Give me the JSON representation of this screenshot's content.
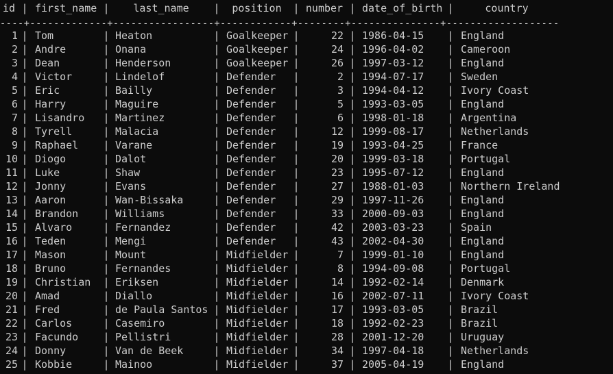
{
  "query_result": {
    "columns": [
      {
        "key": "id",
        "label": "id"
      },
      {
        "key": "first_name",
        "label": "first_name"
      },
      {
        "key": "last_name",
        "label": "last_name"
      },
      {
        "key": "position",
        "label": "position"
      },
      {
        "key": "number",
        "label": "number"
      },
      {
        "key": "date_of_birth",
        "label": "date_of_birth"
      },
      {
        "key": "country",
        "label": "country"
      }
    ],
    "divider": "----+-------------+-----------------+------------+--------+---------------+-------------------",
    "rows": [
      {
        "id": "1",
        "first_name": "Tom",
        "last_name": "Heaton",
        "position": "Goalkeeper",
        "number": "22",
        "date_of_birth": "1986-04-15",
        "country": "England"
      },
      {
        "id": "2",
        "first_name": "Andre",
        "last_name": "Onana",
        "position": "Goalkeeper",
        "number": "24",
        "date_of_birth": "1996-04-02",
        "country": "Cameroon"
      },
      {
        "id": "3",
        "first_name": "Dean",
        "last_name": "Henderson",
        "position": "Goalkeeper",
        "number": "26",
        "date_of_birth": "1997-03-12",
        "country": "England"
      },
      {
        "id": "4",
        "first_name": "Victor",
        "last_name": "Lindelof",
        "position": "Defender",
        "number": "2",
        "date_of_birth": "1994-07-17",
        "country": "Sweden"
      },
      {
        "id": "5",
        "first_name": "Eric",
        "last_name": "Bailly",
        "position": "Defender",
        "number": "3",
        "date_of_birth": "1994-04-12",
        "country": "Ivory Coast"
      },
      {
        "id": "6",
        "first_name": "Harry",
        "last_name": "Maguire",
        "position": "Defender",
        "number": "5",
        "date_of_birth": "1993-03-05",
        "country": "England"
      },
      {
        "id": "7",
        "first_name": "Lisandro",
        "last_name": "Martinez",
        "position": "Defender",
        "number": "6",
        "date_of_birth": "1998-01-18",
        "country": "Argentina"
      },
      {
        "id": "8",
        "first_name": "Tyrell",
        "last_name": "Malacia",
        "position": "Defender",
        "number": "12",
        "date_of_birth": "1999-08-17",
        "country": "Netherlands"
      },
      {
        "id": "9",
        "first_name": "Raphael",
        "last_name": "Varane",
        "position": "Defender",
        "number": "19",
        "date_of_birth": "1993-04-25",
        "country": "France"
      },
      {
        "id": "10",
        "first_name": "Diogo",
        "last_name": "Dalot",
        "position": "Defender",
        "number": "20",
        "date_of_birth": "1999-03-18",
        "country": "Portugal"
      },
      {
        "id": "11",
        "first_name": "Luke",
        "last_name": "Shaw",
        "position": "Defender",
        "number": "23",
        "date_of_birth": "1995-07-12",
        "country": "England"
      },
      {
        "id": "12",
        "first_name": "Jonny",
        "last_name": "Evans",
        "position": "Defender",
        "number": "27",
        "date_of_birth": "1988-01-03",
        "country": "Northern Ireland"
      },
      {
        "id": "13",
        "first_name": "Aaron",
        "last_name": "Wan-Bissaka",
        "position": "Defender",
        "number": "29",
        "date_of_birth": "1997-11-26",
        "country": "England"
      },
      {
        "id": "14",
        "first_name": "Brandon",
        "last_name": "Williams",
        "position": "Defender",
        "number": "33",
        "date_of_birth": "2000-09-03",
        "country": "England"
      },
      {
        "id": "15",
        "first_name": "Alvaro",
        "last_name": "Fernandez",
        "position": "Defender",
        "number": "42",
        "date_of_birth": "2003-03-23",
        "country": "Spain"
      },
      {
        "id": "16",
        "first_name": "Teden",
        "last_name": "Mengi",
        "position": "Defender",
        "number": "43",
        "date_of_birth": "2002-04-30",
        "country": "England"
      },
      {
        "id": "17",
        "first_name": "Mason",
        "last_name": "Mount",
        "position": "Midfielder",
        "number": "7",
        "date_of_birth": "1999-01-10",
        "country": "England"
      },
      {
        "id": "18",
        "first_name": "Bruno",
        "last_name": "Fernandes",
        "position": "Midfielder",
        "number": "8",
        "date_of_birth": "1994-09-08",
        "country": "Portugal"
      },
      {
        "id": "19",
        "first_name": "Christian",
        "last_name": "Eriksen",
        "position": "Midfielder",
        "number": "14",
        "date_of_birth": "1992-02-14",
        "country": "Denmark"
      },
      {
        "id": "20",
        "first_name": "Amad",
        "last_name": "Diallo",
        "position": "Midfielder",
        "number": "16",
        "date_of_birth": "2002-07-11",
        "country": "Ivory Coast"
      },
      {
        "id": "21",
        "first_name": "Fred",
        "last_name": "de Paula Santos",
        "position": "Midfielder",
        "number": "17",
        "date_of_birth": "1993-03-05",
        "country": "Brazil"
      },
      {
        "id": "22",
        "first_name": "Carlos",
        "last_name": "Casemiro",
        "position": "Midfielder",
        "number": "18",
        "date_of_birth": "1992-02-23",
        "country": "Brazil"
      },
      {
        "id": "23",
        "first_name": "Facundo",
        "last_name": "Pellistri",
        "position": "Midfielder",
        "number": "28",
        "date_of_birth": "2001-12-20",
        "country": "Uruguay"
      },
      {
        "id": "24",
        "first_name": "Donny",
        "last_name": "Van de Beek",
        "position": "Midfielder",
        "number": "34",
        "date_of_birth": "1997-04-18",
        "country": "Netherlands"
      },
      {
        "id": "25",
        "first_name": "Kobbie",
        "last_name": "Mainoo",
        "position": "Midfielder",
        "number": "37",
        "date_of_birth": "2005-04-19",
        "country": "England"
      }
    ]
  },
  "colors": {
    "background": "#0c0c0c",
    "foreground": "#cccccc"
  }
}
